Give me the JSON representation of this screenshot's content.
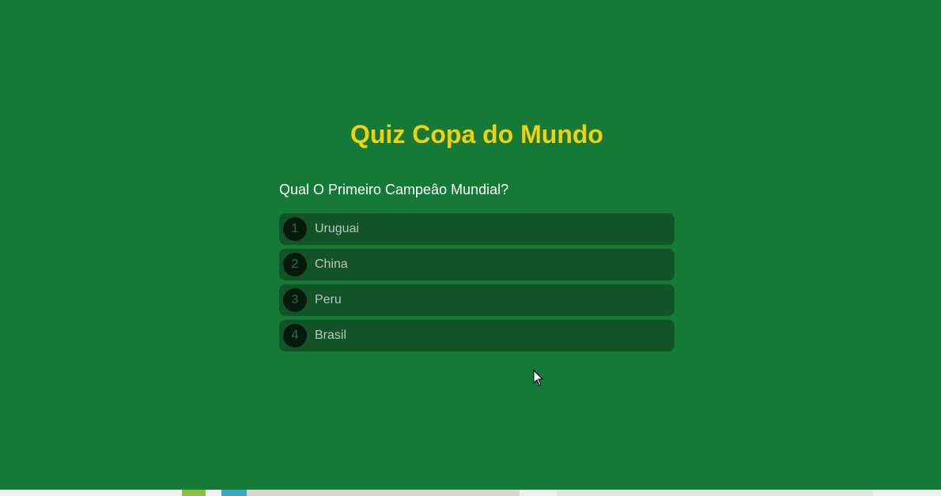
{
  "quiz": {
    "title": "Quiz Copa do Mundo",
    "question": "Qual O Primeiro Campeâo Mundial?",
    "options": [
      {
        "number": "1",
        "label": "Uruguai"
      },
      {
        "number": "2",
        "label": "China"
      },
      {
        "number": "3",
        "label": "Peru"
      },
      {
        "number": "4",
        "label": "Brasil"
      }
    ]
  },
  "colors": {
    "background": "#157a37",
    "title": "#f2d10c",
    "option_bg": "#125428",
    "number_bg": "#061a0c"
  },
  "icons": [
    "mouse-cursor-icon"
  ]
}
